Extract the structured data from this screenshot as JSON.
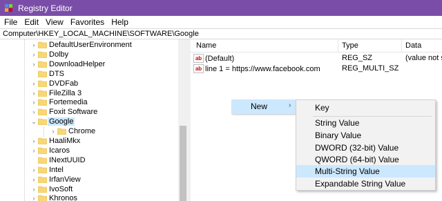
{
  "window": {
    "title": "Registry Editor"
  },
  "menu": [
    "File",
    "Edit",
    "View",
    "Favorites",
    "Help"
  ],
  "address": "Computer\\HKEY_LOCAL_MACHINE\\SOFTWARE\\Google",
  "tree": [
    {
      "label": "DefaultUserEnvironment",
      "chev": "›"
    },
    {
      "label": "Dolby",
      "chev": "›"
    },
    {
      "label": "DownloadHelper",
      "chev": "›"
    },
    {
      "label": "DTS",
      "chev": ""
    },
    {
      "label": "DVDFab",
      "chev": "›"
    },
    {
      "label": "FileZilla 3",
      "chev": "›"
    },
    {
      "label": "Fortemedia",
      "chev": "›"
    },
    {
      "label": "Foxit Software",
      "chev": "›"
    },
    {
      "label": "Google",
      "chev": "⌄"
    },
    {
      "label": "Chrome",
      "chev": "›"
    },
    {
      "label": "HaaliMkx",
      "chev": "›"
    },
    {
      "label": "Icaros",
      "chev": "›"
    },
    {
      "label": "INextUUID",
      "chev": ""
    },
    {
      "label": "Intel",
      "chev": "›"
    },
    {
      "label": "IrfanView",
      "chev": "›"
    },
    {
      "label": "IvoSoft",
      "chev": "›"
    },
    {
      "label": "Khronos",
      "chev": "›"
    }
  ],
  "columns": {
    "name": "Name",
    "type": "Type",
    "data": "Data"
  },
  "values": [
    {
      "name": "(Default)",
      "type": "REG_SZ",
      "data": "(value not set)"
    },
    {
      "name": "line 1 = https://www.facebook.com",
      "type": "REG_MULTI_SZ",
      "data": ""
    }
  ],
  "context_menu": {
    "new_label": "New",
    "arrow": "›"
  },
  "submenu": [
    "Key",
    "String Value",
    "Binary Value",
    "DWORD (32-bit) Value",
    "QWORD (64-bit) Value",
    "Multi-String Value",
    "Expandable String Value"
  ],
  "submenu_highlighted": "Multi-String Value",
  "colors": {
    "titlebar": "#7a4ea8",
    "selection": "#cce8ff",
    "folder": "#f8d775",
    "submenu_bg": "#f2f2f2"
  }
}
